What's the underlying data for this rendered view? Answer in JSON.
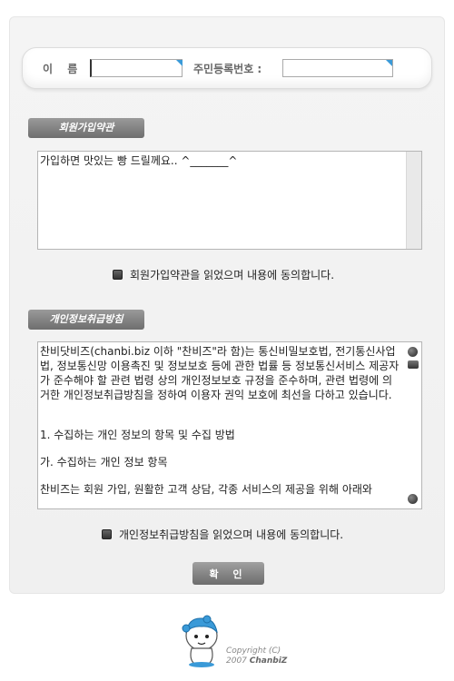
{
  "form": {
    "name_label": "이 름 :",
    "name_value": "",
    "jumin_label": "주민등록번호 :",
    "jumin_value": ""
  },
  "terms": {
    "badge": "회원가입약관",
    "text": "가입하면 맛있는 빵 드릴께요.. ^_______^",
    "agree_label": "회원가입약관을 읽었으며 내용에 동의합니다."
  },
  "privacy": {
    "badge": "개인정보취급방침",
    "paragraphs": [
      "찬비닷비즈(chanbi.biz 이하 \"찬비즈\"라 함)는 통신비밀보호법, 전기통신사업법, 정보통신망 이용촉진 및 정보보호 등에 관한 법률 등 정보통신서비스 제공자가 준수해야 할 관련 법령 상의 개인정보보호 규정을 준수하며, 관련 법령에 의거한 개인정보취급방침을 정하여 이용자 권익 보호에 최선을 다하고 있습니다.",
      "1. 수집하는 개인 정보의 항목 및 수집 방법",
      "가. 수집하는 개인 정보 항목",
      "찬비즈는 회원 가입, 원활한 고객 상담, 각종 서비스의 제공을 위해 아래와"
    ],
    "agree_label": "개인정보취급방침을 읽었으며 내용에 동의합니다."
  },
  "confirm_label": "확 인",
  "footer": {
    "copyright_line1": "Copyright (C)",
    "copyright_year": "2007",
    "copyright_brand": "ChanbiZ"
  }
}
